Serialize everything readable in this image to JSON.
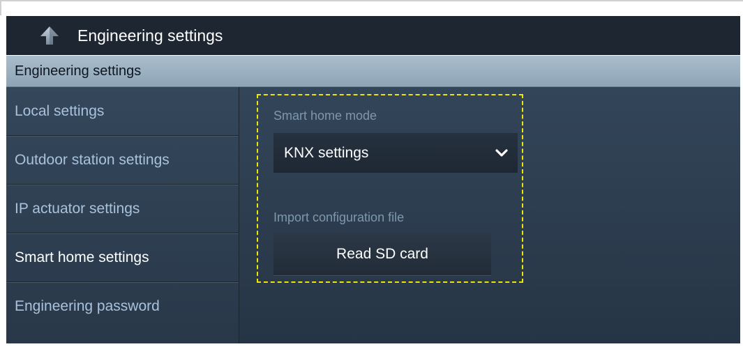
{
  "header": {
    "title": "Engineering settings",
    "back_icon": "arrow-up-icon"
  },
  "section": {
    "title": "Engineering settings"
  },
  "sidebar": {
    "items": [
      {
        "label": "Local settings",
        "active": false
      },
      {
        "label": "Outdoor station settings",
        "active": false
      },
      {
        "label": "IP actuator settings",
        "active": false
      },
      {
        "label": "Smart home settings",
        "active": true
      },
      {
        "label": "Engineering password",
        "active": false
      }
    ]
  },
  "main": {
    "mode_label": "Smart home mode",
    "mode_value": "KNX settings",
    "import_label": "Import configuration file",
    "read_button": "Read SD card"
  },
  "colors": {
    "highlight": "#f0e700",
    "header_bg": "#1d2631",
    "section_bg": "#a9bccb",
    "content_bg": "#2e3f52"
  }
}
